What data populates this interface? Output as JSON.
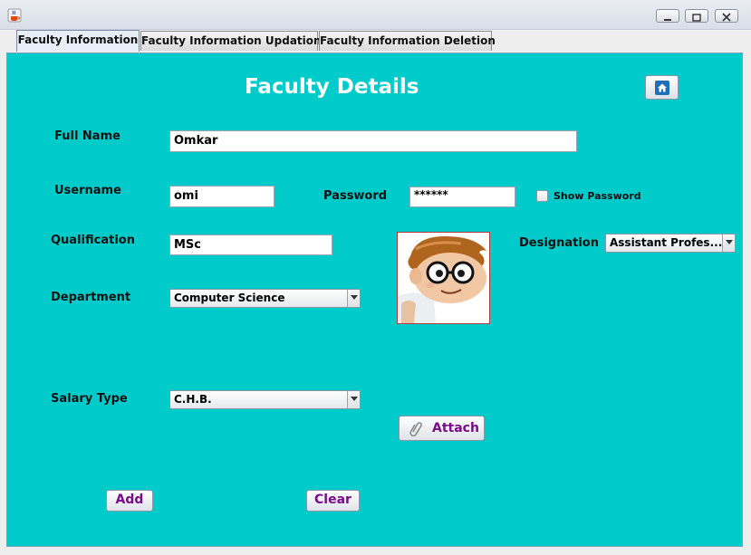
{
  "window": {
    "icon": "java-cup-icon",
    "buttons": [
      "minimize-icon",
      "restore-icon",
      "close-icon"
    ]
  },
  "tabs": [
    {
      "label": "Faculty Information",
      "active": true
    },
    {
      "label": "Faculty Information Updation",
      "active": false
    },
    {
      "label": "Faculty Information Deletion",
      "active": false
    }
  ],
  "form": {
    "title": "Faculty Details",
    "home_icon": "home-icon",
    "full_name": {
      "label": "Full Name",
      "value": "Omkar"
    },
    "username": {
      "label": "Username",
      "value": "omi"
    },
    "password": {
      "label": "Password",
      "value": "******"
    },
    "show_password": {
      "label": "Show Password",
      "checked": false
    },
    "qualification": {
      "label": "Qualification",
      "value": "MSc"
    },
    "designation": {
      "label": "Designation",
      "selected": "Assistant Profes..."
    },
    "department": {
      "label": "Department",
      "selected": "Computer Science"
    },
    "salary_type": {
      "label": "Salary Type",
      "selected": "C.H.B."
    },
    "photo": "cartoon-boy-with-glasses-photo",
    "attach_button": "Attach",
    "add_button": "Add",
    "clear_button": "Clear"
  },
  "colors": {
    "panel_bg": "#00cbcb",
    "button_text": "#7a0b8a",
    "title_text": "#ffffff"
  }
}
